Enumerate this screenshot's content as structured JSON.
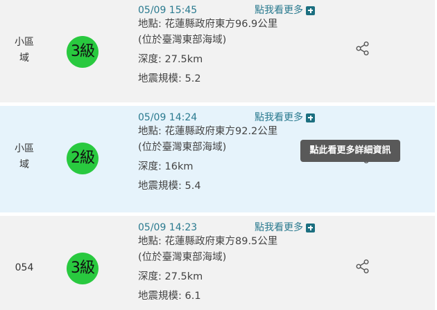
{
  "records": [
    {
      "region": "小區域",
      "intensity": "3級",
      "time": "05/09 15:45",
      "more_label": "點我看更多",
      "location": "地點: 花蓮縣政府東方96.9公里",
      "location_detail": "(位於臺灣東部海域)",
      "depth": "深度: 27.5km",
      "magnitude": "地震規模: 5.2"
    },
    {
      "region": "小區域",
      "intensity": "2級",
      "time": "05/09 14:24",
      "more_label": "點我看更多",
      "location": "地點: 花蓮縣政府東方92.2公里",
      "location_detail": "(位於臺灣東部海域)",
      "depth": "深度: 16km",
      "magnitude": "地震規模: 5.4"
    },
    {
      "region": "054",
      "intensity": "3級",
      "time": "05/09 14:23",
      "more_label": "點我看更多",
      "location": "地點: 花蓮縣政府東方89.5公里",
      "location_detail": "(位於臺灣東部海域)",
      "depth": "深度: 27.5km",
      "magnitude": "地震規模: 6.1"
    }
  ],
  "tooltip": "點此看更多詳細資訊",
  "colors": {
    "badge_green": "#29c93f",
    "accent_teal": "#2a7a8f",
    "highlight_row": "#e6f3fb"
  }
}
